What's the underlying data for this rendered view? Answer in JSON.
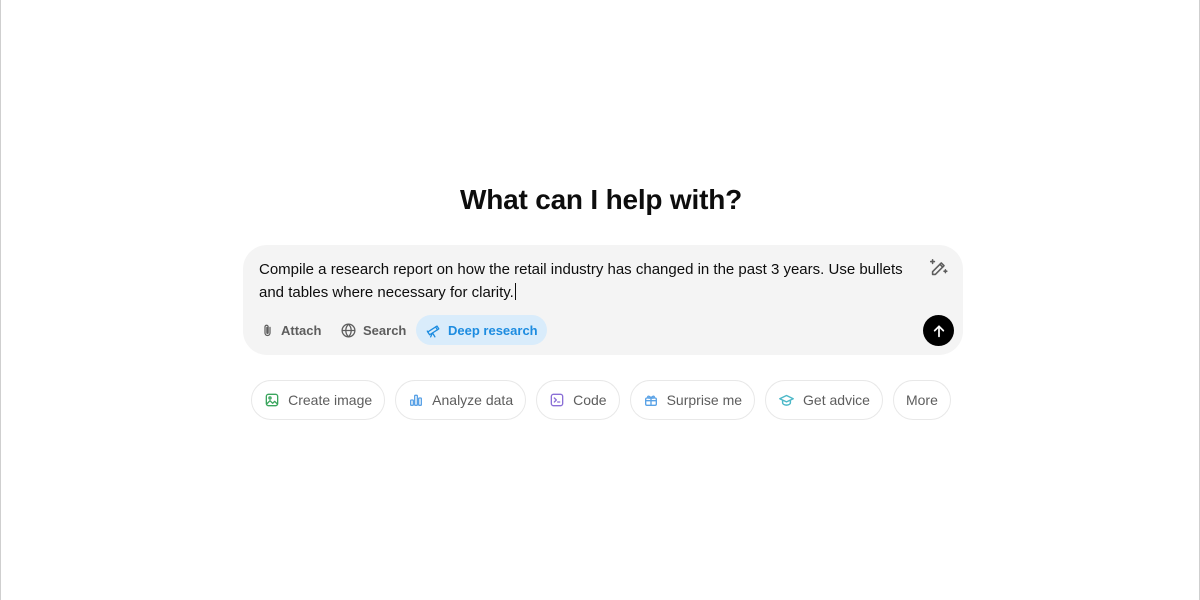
{
  "heading": "What can I help with?",
  "composer": {
    "prompt_line1": "Compile a research report on how the retail industry has changed in the past 3 years. Use bullets",
    "prompt_line2": "and tables where necessary for clarity.",
    "tools": {
      "attach": "Attach",
      "search": "Search",
      "deep_research": "Deep research"
    },
    "icons": {
      "edit": "pencil-sparkle-icon",
      "attach": "paperclip-icon",
      "search": "globe-icon",
      "deep_research": "telescope-icon",
      "send": "arrow-up-icon"
    },
    "deep_research_active": true
  },
  "chips": [
    {
      "label": "Create image",
      "icon": "image-icon",
      "color": "#3aa55d"
    },
    {
      "label": "Analyze data",
      "icon": "bar-chart-icon",
      "color": "#5aa2e6"
    },
    {
      "label": "Code",
      "icon": "terminal-icon",
      "color": "#8a6fd6"
    },
    {
      "label": "Surprise me",
      "icon": "gift-icon",
      "color": "#5aa2e6"
    },
    {
      "label": "Get advice",
      "icon": "graduation-cap-icon",
      "color": "#4cb8c8"
    },
    {
      "label": "More",
      "icon": "",
      "color": ""
    }
  ],
  "colors": {
    "composer_bg": "#f4f4f4",
    "deep_research_bg": "#d9ecfb",
    "deep_research_text": "#1d8ce0",
    "send_bg": "#000000"
  }
}
